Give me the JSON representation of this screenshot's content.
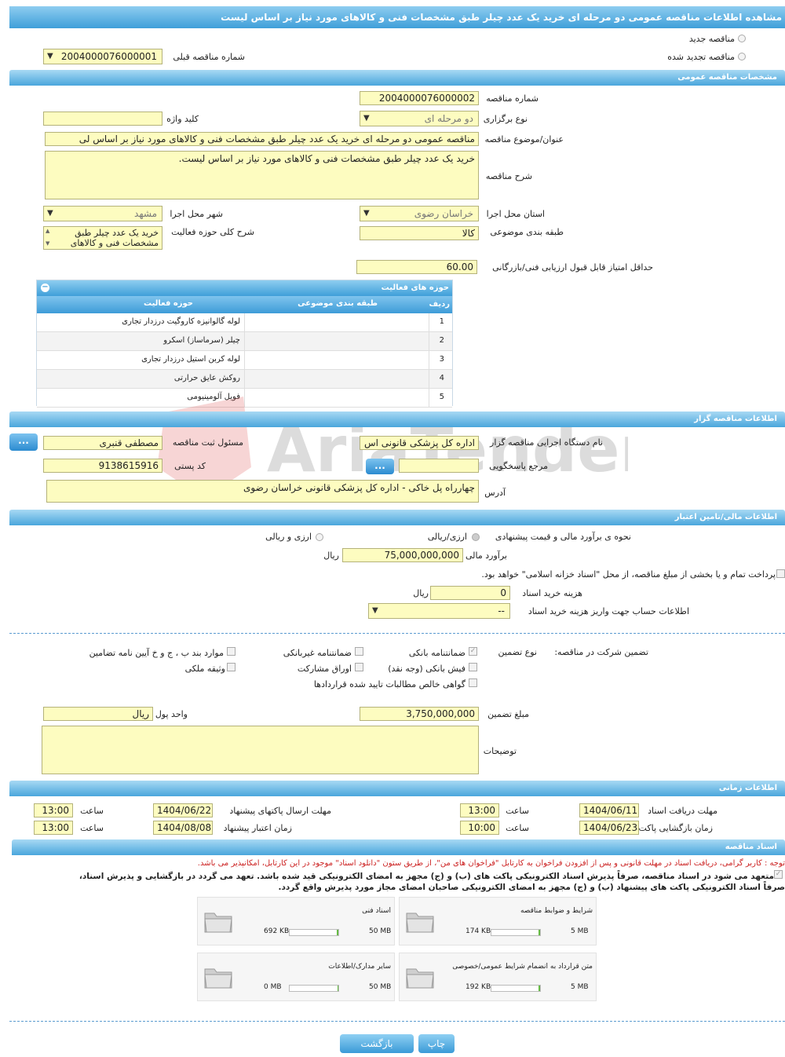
{
  "title": "مشاهده اطلاعات مناقصه عمومی دو مرحله ای خرید یک عدد چیلر طبق مشخصات فنی و کالاهای مورد نیاز بر اساس لیست",
  "top": {
    "radio_new": "مناقصه جدید",
    "radio_renewed": "مناقصه تجدید شده",
    "prev_tender_label": "شماره مناقصه قبلی",
    "prev_tender_value": "2004000076000001"
  },
  "sections": {
    "general": "مشخصات مناقصه عمومی",
    "organizer": "اطلاعات مناقصه گزار",
    "finance": "اطلاعات مالی/تامین اعتبار",
    "timing": "اطلاعات زمانی",
    "documents": "اسناد مناقصه"
  },
  "general": {
    "tender_no_label": "شماره مناقصه",
    "tender_no": "2004000076000002",
    "type_label": "نوع برگزاری",
    "type_value": "دو مرحله ای",
    "keyword_label": "کلید واژه",
    "keyword_value": "",
    "subject_label": "عنوان/موضوع مناقصه",
    "subject_value": "مناقصه عمومی دو مرحله ای خرید یک عدد چیلر طبق مشخصات فنی و کالاهای مورد نیاز بر اساس لی",
    "desc_label": "شرح مناقصه",
    "desc_value": "خرید یک عدد چیلر طبق مشخصات فنی و کالاهای مورد نیاز بر اساس لیست.",
    "province_label": "استان محل اجرا",
    "province_value": "خراسان رضوی",
    "city_label": "شهر محل اجرا",
    "city_value": "مشهد",
    "category_label": "طبقه بندی موضوعی",
    "category_value": "کالا",
    "activity_desc_label": "شرح کلی حوزه فعالیت",
    "activity_desc_value": "خرید یک عدد چیلر طبق مشخصات فنی و کالاهای",
    "min_score_label": "حداقل امتیاز قابل قبول ارزیابی فنی/بازرگانی",
    "min_score_value": "60.00"
  },
  "activity_table": {
    "title": "حوزه های فعالیت",
    "col_row": "ردیف",
    "col_category": "طبقه بندی موضوعی",
    "col_activity": "حوزه فعالیت",
    "rows": [
      {
        "n": "1",
        "cat": "",
        "act": "لوله گالوانیزه کاروگیت درزدار تجاری"
      },
      {
        "n": "2",
        "cat": "",
        "act": "چیلر (سرماساز) اسکرو"
      },
      {
        "n": "3",
        "cat": "",
        "act": "لوله کربن استیل درزدار تجاری"
      },
      {
        "n": "4",
        "cat": "",
        "act": "روکش عایق حرارتی"
      },
      {
        "n": "5",
        "cat": "",
        "act": "فویل آلومینیومی"
      }
    ]
  },
  "organizer": {
    "exec_label": "نام دستگاه اجرایی مناقصه گزار",
    "exec_value": "اداره کل پزشکی قانونی اس",
    "registrar_label": "مسئول ثبت مناقصه",
    "registrar_value": "مصطفی قنبری",
    "responder_label": "مرجع پاسخگویی",
    "responder_value": "",
    "postal_label": "کد پستی",
    "postal_value": "9138615916",
    "address_label": "آدرس",
    "address_value": "چهارراه پل خاکی - اداره کل پزشکی قانونی خراسان رضوی",
    "dots": "..."
  },
  "finance": {
    "estimate_method_label": "نحوه ی برآورد مالی و قیمت پیشنهادی",
    "opt_rial": "ارزی/ریالی",
    "opt_fx": "ارزی و ریالی",
    "estimate_label": "برآورد مالی",
    "estimate_value": "75,000,000,000",
    "estimate_unit": "ریال",
    "treasury_text": "پرداخت تمام و یا بخشی از مبلغ مناقصه، از محل \"اسناد خزانه اسلامی\" خواهد بود.",
    "doc_cost_label": "هزینه خرید اسناد",
    "doc_cost_value": "0",
    "doc_cost_unit": "ریال",
    "account_label": "اطلاعات حساب جهت واریز هزینه خرید اسناد",
    "account_value": "--"
  },
  "guarantee": {
    "label": "تضمین شرکت در مناقصه:",
    "type_label": "نوع تضمین",
    "bank_guarantee": "ضمانتنامه بانکی",
    "nonbank_guarantee": "ضمانتنامه غیربانکی",
    "clause_items": "موارد بند ب ، ج و خ آیین نامه تضامین",
    "bank_receipt": "فیش بانکی (وجه نقد)",
    "participation_papers": "اوراق مشارکت",
    "property_deed": "وثیقه ملکی",
    "receivables": "گواهی خالص مطالبات تایید شده قراردادها",
    "amount_label": "مبلغ تضمین",
    "amount_value": "3,750,000,000",
    "currency_label": "واحد پول",
    "currency_value": "ریال",
    "notes_label": "توضیحات",
    "notes_value": ""
  },
  "timing": {
    "doc_receive_label": "مهلت دریافت اسناد",
    "doc_receive_date": "1404/06/11",
    "doc_receive_time": "13:00",
    "send_label": "مهلت ارسال پاکتهای پیشنهاد",
    "send_date": "1404/06/22",
    "send_time": "13:00",
    "open_label": "زمان بازگشایی پاکت ها",
    "open_date": "1404/06/23",
    "open_time": "10:00",
    "validity_label": "زمان اعتبار پیشنهاد",
    "validity_date": "1404/08/08",
    "validity_time": "13:00",
    "time_label": "ساعت"
  },
  "documents": {
    "notice": "توجه : کاربر گرامی، دریافت اسناد در مهلت قانونی و پس از افزودن فراخوان به کارتابل \"فراخوان های من\"، از طریق ستون \"دانلود اسناد\" موجود در این کارتابل، امکانپذیر می باشد.",
    "commit_line1": "متعهد می شود در اسناد مناقصه، صرفاً پذیرش اسناد الکترونیکی پاکت های (ب) و (ج) مجهز به امضای الکترونیکی قید شده باشد. تعهد می گردد در بازگشایی و پذیرش اسناد،",
    "commit_line2": "صرفاً اسناد الکترونیکی پاکت های پیشنهاد (ب) و (ج) مجهز به امضای الکترونیکی صاحبان امضای مجاز مورد پذیرش واقع گردد.",
    "tiles": [
      {
        "name": "شرایط و ضوابط مناقصه",
        "size": "174 KB",
        "max": "5 MB",
        "fill": 0.04
      },
      {
        "name": "اسناد فنی",
        "size": "692 KB",
        "max": "50 MB",
        "fill": 0.03
      },
      {
        "name": "متن قرارداد به انضمام شرایط عمومی/خصوصی",
        "size": "192 KB",
        "max": "5 MB",
        "fill": 0.04
      },
      {
        "name": "سایر مدارک/اطلاعات",
        "size": "0 MB",
        "max": "50 MB",
        "fill": 0.0
      }
    ]
  },
  "buttons": {
    "print": "چاپ",
    "back": "بازگشت"
  },
  "watermark": "AriaTender.neT",
  "colors": {
    "header_blue": "#3f9fd9",
    "field_yellow": "#fdfcc0",
    "notice_red": "#cc2222"
  }
}
